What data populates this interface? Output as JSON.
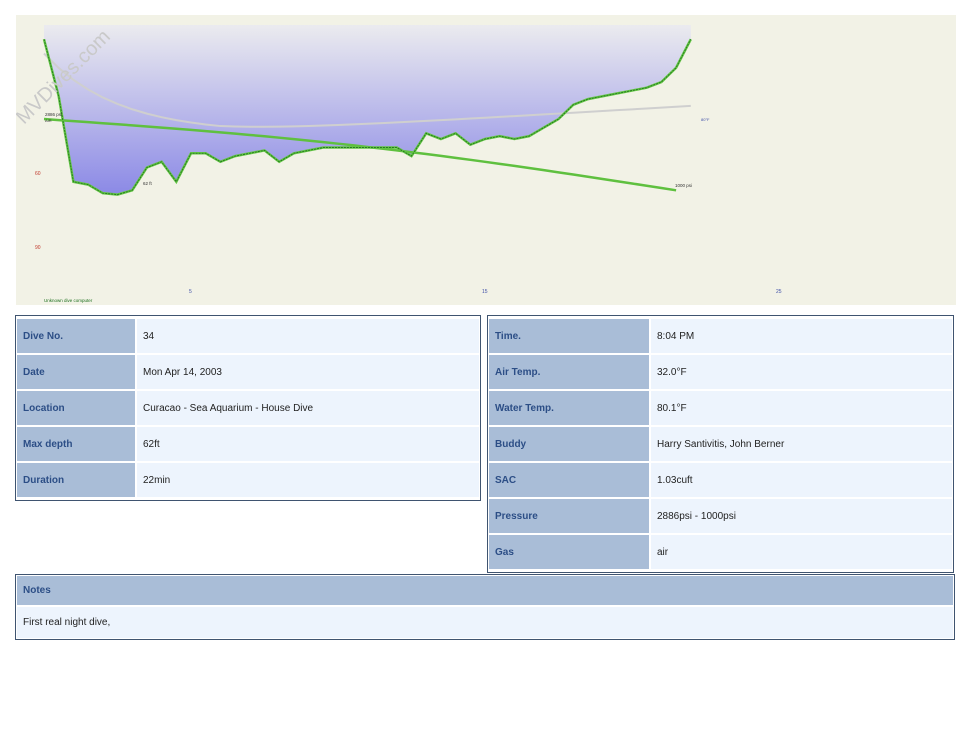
{
  "watermark": "MVDives.com",
  "chart_data": {
    "type": "line",
    "x_ticks": [
      "5",
      "15",
      "25"
    ],
    "y_ticks": [
      "60",
      "90"
    ],
    "xlim": [
      0,
      30
    ],
    "ylim": [
      0,
      105
    ],
    "computer_label": "Unknown dive computer",
    "start_pressure_label": "2886 psi",
    "gas_label": "AIR",
    "end_pressure_label": "1000 psi",
    "max_depth_label": "62 ft",
    "end_temp_label": "80°F",
    "series": [
      {
        "values_x": [
          0,
          0.5,
          1,
          1.5,
          2,
          2.5,
          3,
          3.5,
          4,
          4.5,
          5,
          5.5,
          6,
          6.5,
          7,
          7.5,
          8,
          8.5,
          9,
          9.5,
          10,
          10.5,
          11,
          11.5,
          12,
          12.5,
          13,
          13.5,
          14,
          14.5,
          15,
          15.5,
          16,
          16.5,
          17,
          17.5,
          18,
          18.5,
          19,
          19.5,
          20,
          20.5,
          21,
          21.5,
          22
        ],
        "values_y": [
          5,
          25,
          55,
          56,
          59,
          59.5,
          58,
          50,
          48,
          55,
          45,
          45,
          48,
          46,
          45,
          44,
          48,
          45,
          44,
          43,
          43,
          43,
          43,
          43,
          43,
          46,
          38,
          40,
          38,
          42,
          40,
          39,
          40,
          39,
          36,
          33,
          28,
          26,
          25,
          24,
          23,
          22,
          20,
          15,
          5,
          3
        ]
      }
    ],
    "pressure": {
      "x": [
        0,
        21.5
      ],
      "y": [
        2886,
        1000
      ]
    },
    "colors": {
      "fill_top": "#e8e8ee",
      "fill_bottom": "#8b89e6",
      "profile": "#62c443",
      "profile_dark": "#1d6f1d",
      "pressure": "#5fc03f",
      "pressure_end": "#d3d43a",
      "temp": "#cfcfcf",
      "axis_red": "#c0392b",
      "axis_blue": "#3f4fa8"
    }
  },
  "details_left": [
    {
      "label": "Dive No.",
      "value": "34"
    },
    {
      "label": "Date",
      "value": "Mon Apr 14, 2003"
    },
    {
      "label": "Location",
      "value": "Curacao - Sea Aquarium - House Dive"
    },
    {
      "label": "Max depth",
      "value": "62ft"
    },
    {
      "label": "Duration",
      "value": "22min"
    }
  ],
  "details_right": [
    {
      "label": "Time.",
      "value": "8:04 PM"
    },
    {
      "label": "Air Temp.",
      "value": "32.0°F"
    },
    {
      "label": "Water Temp.",
      "value": "80.1°F"
    },
    {
      "label": "Buddy",
      "value": "Harry Santivitis, John Berner"
    },
    {
      "label": "SAC",
      "value": "1.03cuft"
    },
    {
      "label": "Pressure",
      "value": "2886psi - 1000psi"
    },
    {
      "label": "Gas",
      "value": "air"
    }
  ],
  "notes": {
    "title": "Notes",
    "text": "First real night dive,"
  }
}
